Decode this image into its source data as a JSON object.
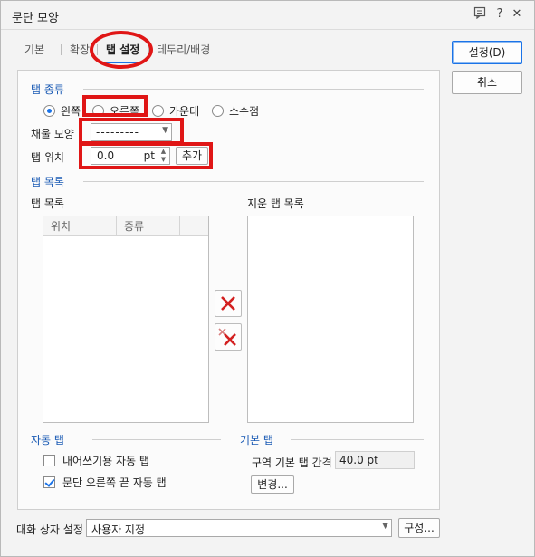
{
  "window": {
    "title": "문단 모양",
    "icons": [
      "comment-icon",
      "help-icon",
      "close-icon"
    ],
    "help_glyph": "?",
    "close_glyph": "✕"
  },
  "tabs": [
    {
      "label": "기본"
    },
    {
      "label": "확장"
    },
    {
      "label": "탭 설정"
    },
    {
      "label": "테두리/배경"
    }
  ],
  "active_tab": "탭 설정",
  "tab_kind": {
    "heading": "탭 종류",
    "options": [
      {
        "label": "왼쪽",
        "selected": true
      },
      {
        "label": "오른쪽",
        "selected": false
      },
      {
        "label": "가운데",
        "selected": false
      },
      {
        "label": "소수점",
        "selected": false
      }
    ]
  },
  "fill": {
    "label": "채울 모양",
    "value": "---------"
  },
  "tab_position": {
    "label": "탭 위치",
    "value": "0.0",
    "unit": "pt",
    "add_button": "추가"
  },
  "tab_list": {
    "heading": "탭 목록",
    "list_label": "탭 목록",
    "columns": [
      "위치",
      "종류"
    ],
    "rows": []
  },
  "removed_list": {
    "label": "지운 탭 목록",
    "rows": []
  },
  "auto_tab": {
    "heading": "자동 탭",
    "options": [
      {
        "label": "내어쓰기용 자동 탭",
        "checked": false
      },
      {
        "label": "문단 오른쪽 끝 자동 탭",
        "checked": true
      }
    ]
  },
  "default_tab": {
    "heading": "기본 탭",
    "interval_label": "구역 기본 탭 간격",
    "interval_value": "40.0 pt",
    "change_button": "변경..."
  },
  "side_buttons": {
    "ok": "설정(D)",
    "cancel": "취소"
  },
  "footer": {
    "label": "대화 상자 설정",
    "select_value": "사용자 지정",
    "config_button": "구성..."
  },
  "colors": {
    "accent": "#1a73e8",
    "annotation": "#e01616",
    "section_heading": "#1a5ab4"
  }
}
